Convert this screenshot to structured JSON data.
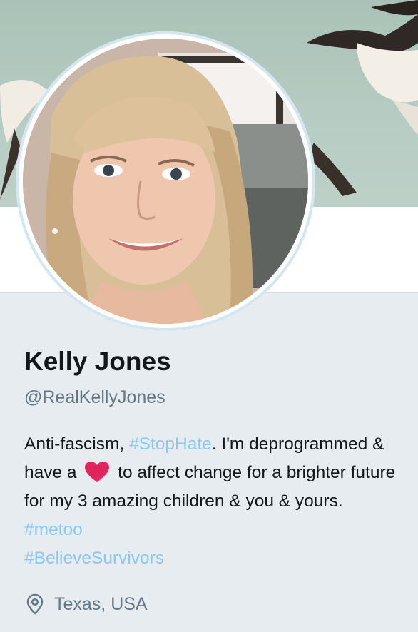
{
  "profile": {
    "name": "Kelly Jones",
    "handle": "@RealKellyJones",
    "bio": {
      "part1": "Anti-fascism, ",
      "tag1": "#StopHate",
      "part2": ". I'm deprogrammed & have a ",
      "heart_icon": "red-heart-icon",
      "part3": " to affect change for a brighter future for my 3 amazing children & you & yours. ",
      "tag2": "#metoo",
      "tag3": "#BelieveSurvivors"
    },
    "location": "Texas, USA",
    "location_icon": "map-pin-icon"
  },
  "colors": {
    "hashtag": "#8ec7ef",
    "heart": "#e0245e",
    "muted": "#657786",
    "background": "#e6ecf0"
  }
}
